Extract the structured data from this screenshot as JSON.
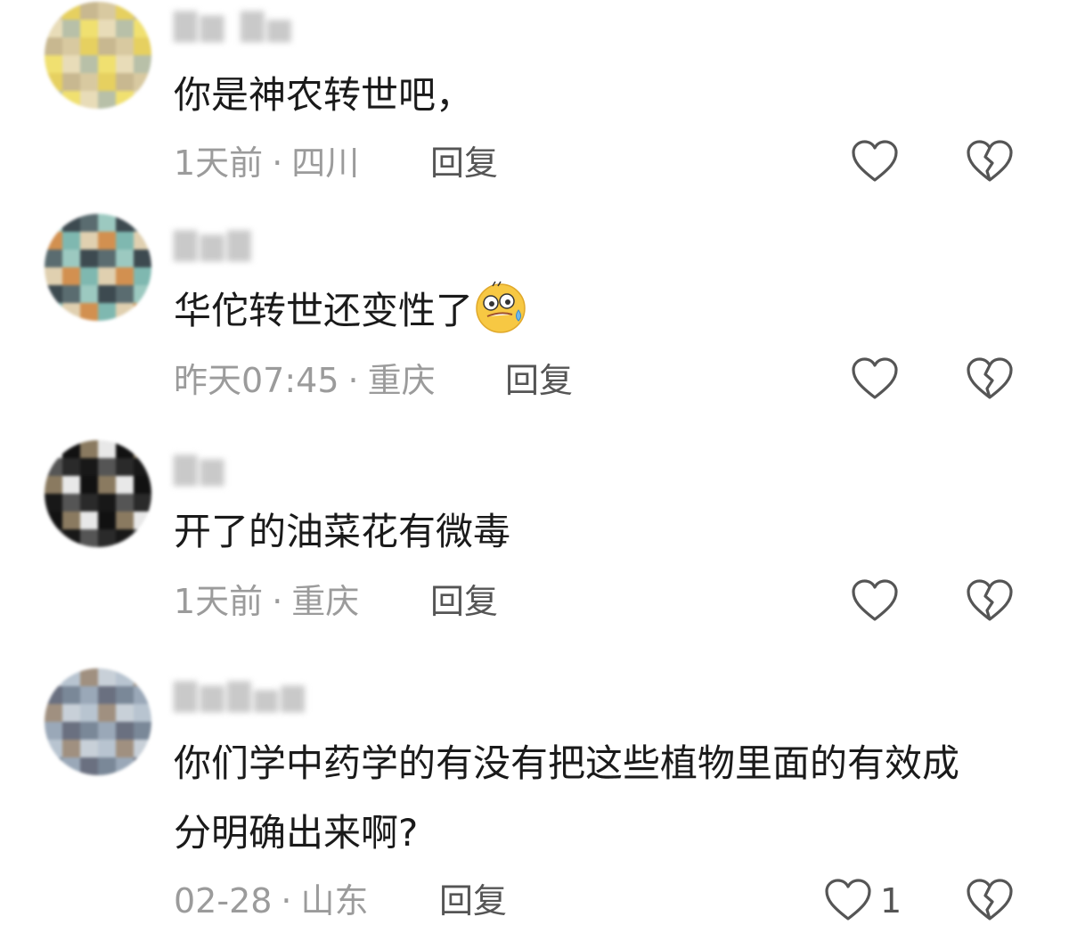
{
  "comments": [
    {
      "text": "你是神农转世吧，",
      "time": "1天前",
      "location": "四川",
      "reply_label": "回复",
      "like_count": "",
      "avatar_colors": [
        "#d8c9a0",
        "#e8dcb8",
        "#c8b890",
        "#f0e070",
        "#e6d060",
        "#b8c0a8"
      ]
    },
    {
      "text": "华佗转世还变性了",
      "emoji": "sweat-smile-emoji",
      "time": "昨天07:45",
      "location": "重庆",
      "reply_label": "回复",
      "like_count": "",
      "avatar_colors": [
        "#7fb8b0",
        "#9cc9c0",
        "#d29050",
        "#5a6c70",
        "#e0d0b0",
        "#3d4a50"
      ]
    },
    {
      "text": "开了的油菜花有微毒",
      "time": "1天前",
      "location": "重庆",
      "reply_label": "回复",
      "like_count": "",
      "avatar_colors": [
        "#111111",
        "#2a2a2a",
        "#e8e8e8",
        "#555555",
        "#8a7a60",
        "#181818"
      ]
    },
    {
      "text": "你们学中药学的有没有把这些植物里面的有效成分明确出来啊?",
      "time": "02-28",
      "location": "山东",
      "reply_label": "回复",
      "like_count": "1",
      "avatar_colors": [
        "#9aa8b8",
        "#b8c4d0",
        "#7a8898",
        "#c8d0d8",
        "#6a7080",
        "#a09080"
      ]
    }
  ],
  "icons": {
    "like": "heart-outline-icon",
    "dislike": "broken-heart-icon"
  },
  "colors": {
    "text_primary": "#1a1a1a",
    "text_meta": "#9b9b9b",
    "reply": "#555555",
    "icon_stroke": "#555555"
  }
}
